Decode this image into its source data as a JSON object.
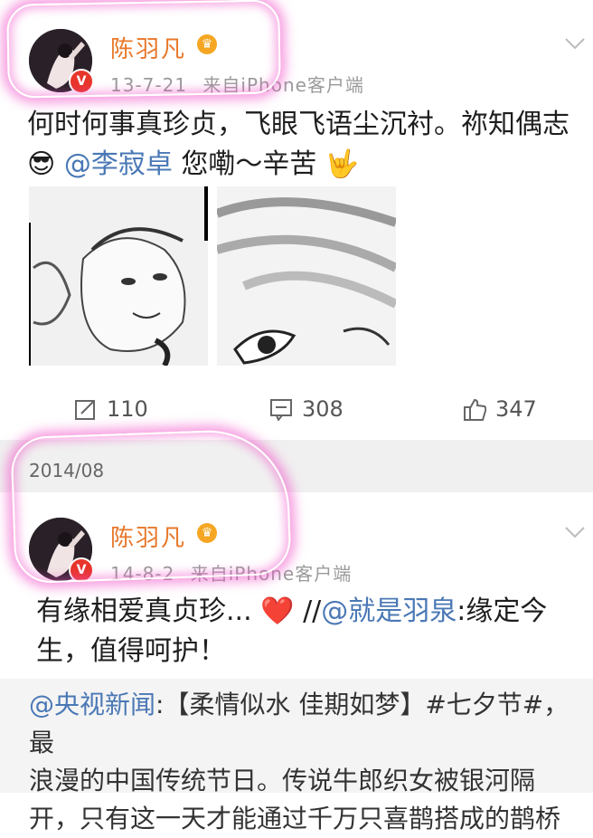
{
  "post1": {
    "username": "陈羽凡",
    "time": "13-7-21",
    "source": "来自iPhone客户端",
    "text_line1": "何时何事真珍贞，飞眼飞语尘沉衬。祢知偶志",
    "mention": "@李寂卓",
    "text_line2_rest": " 您嘞～辛苦",
    "emoji_start": "😎",
    "emoji_end": "🤟",
    "repost_count": "110",
    "comment_count": "308",
    "like_count": "347",
    "verified_badge": "V"
  },
  "divider": {
    "date": "2014/08"
  },
  "post2": {
    "username": "陈羽凡",
    "time": "14-8-2",
    "source": "来自iPhone客户端",
    "text_line1": "有缘相爱真贞珍...",
    "heart": "❤️",
    "repost_prefix": " //",
    "mention": "@就是羽泉",
    "after_mention": ":缘定今",
    "text_line2": "生，值得呵护！",
    "verified_badge": "V"
  },
  "quoted": {
    "mention": "@央视新闻",
    "line1_rest": ":【柔情似水 佳期如梦】#七夕节#，最",
    "line2": "浪漫的中国传统节日。传说牛郎织女被银河隔",
    "line3": "开，只有这一天才能通过千万只喜鹊搭成的鹊桥"
  },
  "icons": {
    "repost": "repost-icon",
    "comment": "comment-icon",
    "like": "like-icon",
    "more": "chevron-down-icon"
  }
}
